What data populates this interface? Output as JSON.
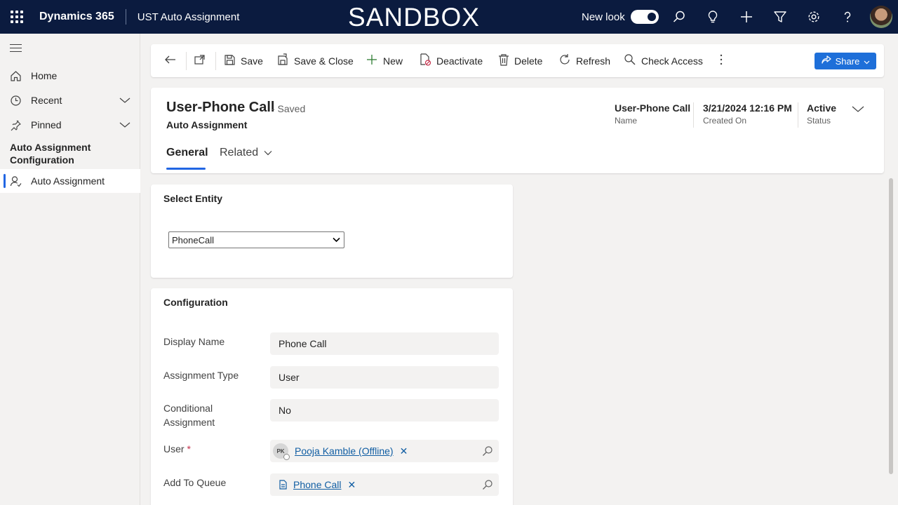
{
  "topbar": {
    "brand": "Dynamics 365",
    "app_name": "UST Auto Assignment",
    "environment": "SANDBOX",
    "new_look_label": "New look",
    "new_look_on": true
  },
  "sidebar": {
    "items": [
      {
        "label": "Home",
        "icon": "home-icon"
      },
      {
        "label": "Recent",
        "icon": "clock-icon"
      },
      {
        "label": "Pinned",
        "icon": "pin-icon"
      }
    ],
    "group_title": "Auto Assignment Configuration",
    "active_item": {
      "label": "Auto Assignment",
      "icon": "person-icon"
    }
  },
  "commands": {
    "save": "Save",
    "save_close": "Save & Close",
    "new": "New",
    "deactivate": "Deactivate",
    "delete": "Delete",
    "refresh": "Refresh",
    "check_access": "Check Access",
    "share": "Share"
  },
  "record": {
    "title": "User-Phone Call",
    "saved_state": "- Saved",
    "entity": "Auto Assignment",
    "header_fields": [
      {
        "value": "User-Phone Call",
        "label": "Name"
      },
      {
        "value": "3/21/2024 12:16 PM",
        "label": "Created On"
      },
      {
        "value": "Active",
        "label": "Status"
      }
    ],
    "tabs": [
      "General",
      "Related"
    ]
  },
  "select_entity": {
    "title": "Select Entity",
    "value": "PhoneCall"
  },
  "configuration": {
    "title": "Configuration",
    "display_name": {
      "label": "Display Name",
      "value": "Phone Call"
    },
    "assignment_type": {
      "label": "Assignment Type",
      "value": "User"
    },
    "conditional_assignment": {
      "label_line1": "Conditional",
      "label_line2": "Assignment",
      "value": "No"
    },
    "user": {
      "label": "User",
      "required_mark": "*",
      "initials": "PK",
      "value": "Pooja Kamble (Offline)"
    },
    "add_to_queue": {
      "label": "Add To Queue",
      "value": "Phone Call"
    }
  },
  "colors": {
    "topbar": "#0b1b3f",
    "accent": "#2266e3",
    "share_button": "#1e6fd9",
    "link": "#115ea3"
  }
}
